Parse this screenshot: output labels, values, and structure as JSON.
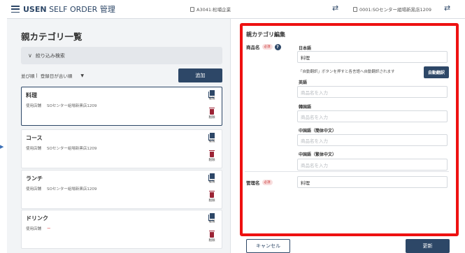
{
  "header": {
    "brand_bold": "USEN",
    "brand_sub": " SELF ORDER 管理",
    "store": "A3041:松埔企業",
    "register": "0001:SOセンター組場新黒店1209"
  },
  "left": {
    "title": "親カテゴリ一覧",
    "filter_label": "絞り込み検索",
    "sort_label": "並び順",
    "sort_value": "登録日が古い順",
    "add_button": "追加",
    "shop_label": "使用店舗",
    "copy_label": "複製",
    "delete_label": "削除",
    "cards": [
      {
        "name": "料理",
        "shop": "SOセンター組場新黒店1209"
      },
      {
        "name": "コース",
        "shop": "SOセンター組場新黒店1209"
      },
      {
        "name": "ランチ",
        "shop": "SOセンター組場新黒店1209"
      },
      {
        "name": "ドリンク",
        "shop": "ー"
      }
    ]
  },
  "editor": {
    "title": "親カテゴリ編集",
    "product_name_label": "商品名",
    "required": "必須",
    "help": "?",
    "japanese_label": "日本語",
    "japanese_value": "料理",
    "auto_note": "「自動翻訳」ボタンを押すと各言語へ自動翻訳されます",
    "auto_button": "自動翻訳",
    "english_label": "英語",
    "korean_label": "韓国語",
    "chinese_simplified_label": "中国語（簡体中文）",
    "chinese_traditional_label": "中国語（繁体中文）",
    "placeholder": "商品名を入力",
    "admin_name_label": "管理名",
    "admin_name_value": "料理"
  },
  "footer": {
    "cancel": "キャンセル",
    "update": "更新"
  },
  "colors": {
    "navy": "#2d4767",
    "highlight": "#ee1111",
    "delete": "#9b2335"
  }
}
